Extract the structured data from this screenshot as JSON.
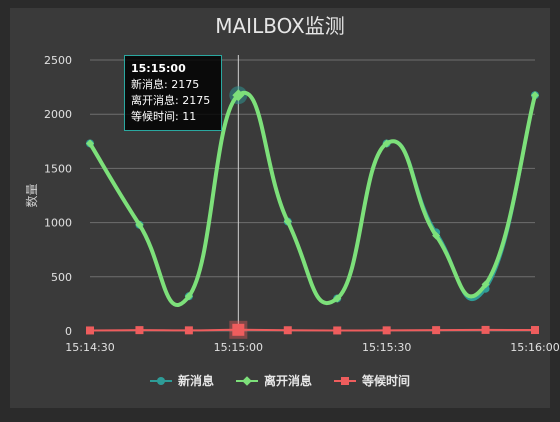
{
  "title": "MAILBOX监测",
  "chart_data": {
    "type": "line",
    "title": "MAILBOX监测",
    "xlabel": "",
    "ylabel": "数量",
    "ylim": [
      0,
      2500
    ],
    "yticks": [
      0,
      500,
      1000,
      1500,
      2000,
      2500
    ],
    "grid": true,
    "legend_position": "bottom",
    "x": [
      "15:14:30",
      "15:14:40",
      "15:14:50",
      "15:15:00",
      "15:15:10",
      "15:15:20",
      "15:15:30",
      "15:15:40",
      "15:15:50",
      "15:16:00"
    ],
    "x_tick_labels": [
      "15:14:30",
      "15:15:00",
      "15:15:30",
      "15:16:00"
    ],
    "series": [
      {
        "name": "新消息",
        "color": "#2e9c97",
        "marker": "circle",
        "values": [
          1730,
          980,
          320,
          2175,
          1010,
          300,
          1730,
          910,
          390,
          2175
        ]
      },
      {
        "name": "离开消息",
        "color": "#7de07a",
        "marker": "diamond",
        "values": [
          1730,
          980,
          320,
          2175,
          1010,
          300,
          1730,
          880,
          430,
          2175
        ]
      },
      {
        "name": "等候时间",
        "color": "#ee5d5d",
        "marker": "square",
        "values": [
          5,
          8,
          6,
          11,
          7,
          5,
          6,
          8,
          10,
          9
        ]
      }
    ],
    "tooltip": {
      "title": "15:15:00",
      "lines": [
        "新消息: 2175",
        "离开消息: 2175",
        "等候时间: 11"
      ]
    }
  }
}
